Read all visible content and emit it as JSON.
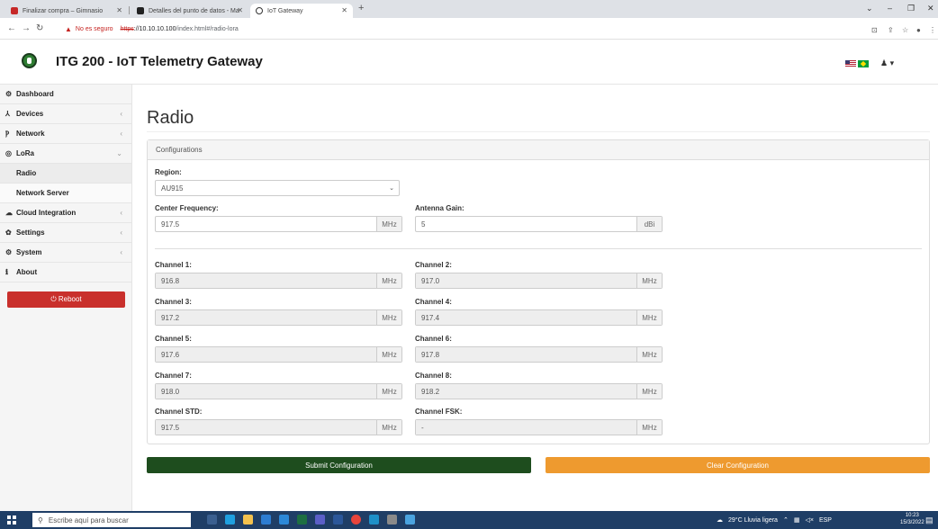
{
  "browser": {
    "tabs": [
      {
        "title": "Finalizar compra – Gimnasio",
        "color": "#c62828"
      },
      {
        "title": "Detalles del punto de datos - Ma",
        "color": "#222222"
      },
      {
        "title": "IoT Gateway",
        "color": "#333333"
      }
    ],
    "new_tab": "+",
    "url": {
      "warning": "▲",
      "insecure_label": "No es seguro",
      "scheme": "https",
      "host": "://10.10.10.100",
      "path": "/index.html#/radio-lora"
    }
  },
  "app": {
    "title": "ITG 200 - IoT Telemetry Gateway",
    "user_caret": "♟ ▾"
  },
  "sidebar": {
    "items": [
      {
        "icon": "⚙",
        "label": "Dashboard",
        "chev": ""
      },
      {
        "icon": "⅄",
        "label": "Devices",
        "chev": "‹"
      },
      {
        "icon": "Ⲣ",
        "label": "Network",
        "chev": "‹"
      },
      {
        "icon": "◎",
        "label": "LoRa",
        "chev": "⌄"
      },
      {
        "icon": "",
        "label": "Radio",
        "chev": ""
      },
      {
        "icon": "",
        "label": "Network Server",
        "chev": ""
      },
      {
        "icon": "☁",
        "label": "Cloud Integration",
        "chev": "‹"
      },
      {
        "icon": "✿",
        "label": "Settings",
        "chev": "‹"
      },
      {
        "icon": "⚙",
        "label": "System",
        "chev": "‹"
      },
      {
        "icon": "ℹ",
        "label": "About",
        "chev": ""
      }
    ],
    "reboot_label": "⏻ Reboot"
  },
  "page": {
    "title": "Radio",
    "panel_heading": "Configurations",
    "region": {
      "label": "Region:",
      "value": "AU915"
    },
    "center_frequency": {
      "label": "Center Frequency:",
      "value": "917.5",
      "unit": "MHz"
    },
    "antenna_gain": {
      "label": "Antenna Gain:",
      "value": "5",
      "unit": "dBi"
    },
    "channels": [
      {
        "label": "Channel 1:",
        "value": "916.8",
        "unit": "MHz"
      },
      {
        "label": "Channel 2:",
        "value": "917.0",
        "unit": "MHz"
      },
      {
        "label": "Channel 3:",
        "value": "917.2",
        "unit": "MHz"
      },
      {
        "label": "Channel 4:",
        "value": "917.4",
        "unit": "MHz"
      },
      {
        "label": "Channel 5:",
        "value": "917.6",
        "unit": "MHz"
      },
      {
        "label": "Channel 6:",
        "value": "917.8",
        "unit": "MHz"
      },
      {
        "label": "Channel 7:",
        "value": "918.0",
        "unit": "MHz"
      },
      {
        "label": "Channel 8:",
        "value": "918.2",
        "unit": "MHz"
      },
      {
        "label": "Channel STD:",
        "value": "917.5",
        "unit": "MHz"
      },
      {
        "label": "Channel FSK:",
        "value": "-",
        "unit": "MHz"
      }
    ],
    "submit_label": "Submit Configuration",
    "clear_label": "Clear Configuration"
  },
  "taskbar": {
    "search_placeholder": "Escribe aquí para buscar",
    "weather": "29°C  Lluvia ligera",
    "language": "ESP",
    "time": "10:23",
    "date": "15/3/2022"
  }
}
